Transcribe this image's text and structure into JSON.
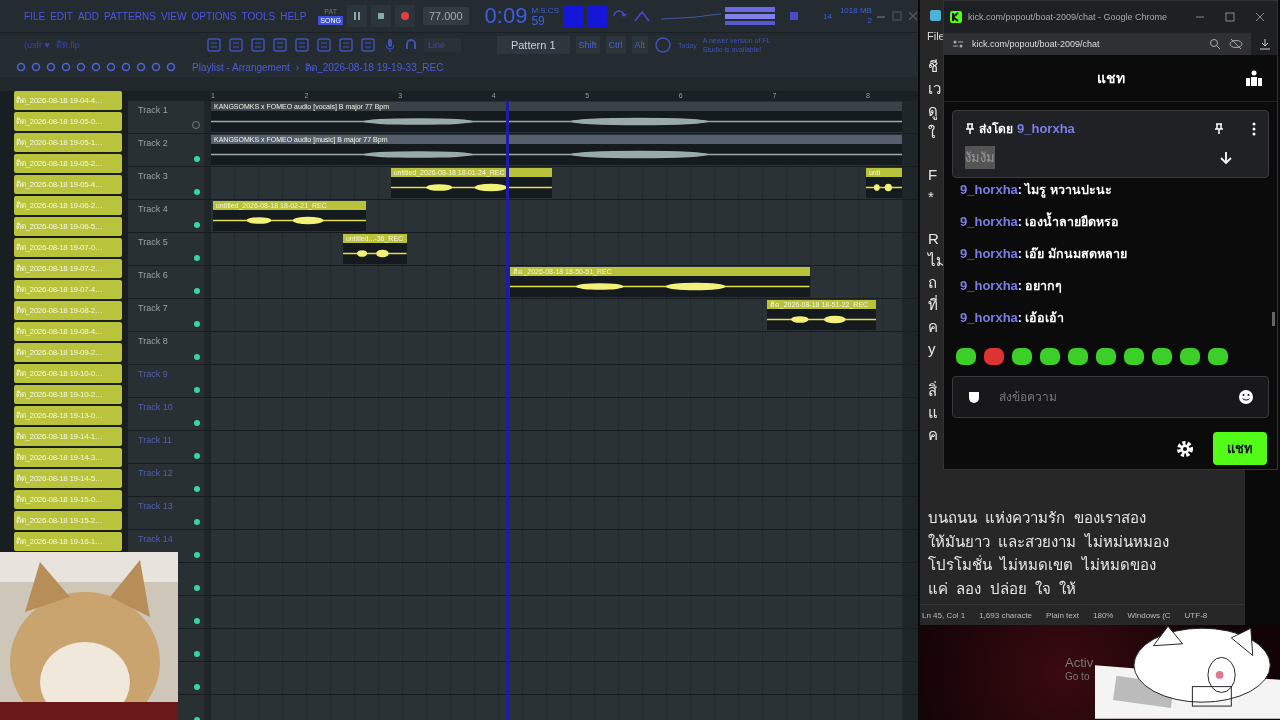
{
  "fl_studio": {
    "menu": [
      "FILE",
      "EDIT",
      "ADD",
      "PATTERNS",
      "VIEW",
      "OPTIONS",
      "TOOLS",
      "HELP"
    ],
    "mode": [
      {
        "label": "PAT",
        "selected": false
      },
      {
        "label": "SONG",
        "selected": true
      }
    ],
    "tempo": "77.000",
    "time": "0:09",
    "time_cs": "59",
    "time_unit": "M:S:CS",
    "cpu": "14",
    "memory": "1018 MB",
    "polyphony": "2",
    "hint": "(usfr ♥",
    "project": "ติด.flp",
    "snap": "Line",
    "pattern": "Pattern 1",
    "keys": [
      "Shift",
      "Ctrl",
      "Alt"
    ],
    "news_day": "Today",
    "news": "A newer version of FL Studio is available!",
    "playlist_title": "Playlist - Arrangement",
    "playlist_separator": "›",
    "playlist_pattern": "ติด_2026-08-18 19-19-33_REC",
    "browser_items": [
      "ติด_2026-08-18 19-04-4…",
      "ติด_2026-08-18 19-05-0…",
      "ติด_2026-08-18 19-05-1…",
      "ติด_2026-08-18 19-05-2…",
      "ติด_2026-08-18 19-05-4…",
      "ติด_2026-08-18 19-06-2…",
      "ติด_2026-08-18 19-06-5…",
      "ติด_2026-08-18 19-07-0…",
      "ติด_2026-08-18 19-07-2…",
      "ติด_2026-08-18 19-07-4…",
      "ติด_2026-08-18 19-08-2…",
      "ติด_2026-08-18 19-08-4…",
      "ติด_2026-08-18 19-09-2…",
      "ติด_2026-08-18 19-10-0…",
      "ติด_2026-08-18 19-10-2…",
      "ติด_2026-08-18 19-13-0…",
      "ติด_2026-08-18 19-14-1…",
      "ติด_2026-08-18 19-14-3…",
      "ติด_2026-08-18 19-14-5…",
      "ติด_2026-08-18 19-15-0…",
      "ติด_2026-08-18 19-15-2…",
      "ติด_2026-08-18 19-16-1…"
    ],
    "ruler": [
      "1",
      "2",
      "3",
      "4",
      "5",
      "6",
      "7",
      "8"
    ],
    "tracks": [
      {
        "label": "Track 1",
        "muted": true,
        "empty": false,
        "clips": [
          {
            "name": "KANGSOMKS x FOMEO audio [vocals] B major 77 Bpm",
            "color": "#3a4248"
          }
        ]
      },
      {
        "label": "Track 2",
        "muted": false,
        "empty": false,
        "clips": [
          {
            "name": "KANGSOMKS x FOMEO audio [music] B major 77 Bpm",
            "color": "#56606c"
          }
        ]
      },
      {
        "label": "Track 3",
        "muted": false,
        "empty": false,
        "clips": [
          {
            "name": "untitled_2026-08-18 18-01-24_REC",
            "color": "#b8c23a"
          },
          {
            "name": "unti",
            "color": "#b8c23a"
          }
        ]
      },
      {
        "label": "Track 4",
        "muted": false,
        "empty": false,
        "clips": [
          {
            "name": "untitled_2026-08-18 18-02-21_REC",
            "color": "#b8c23a"
          }
        ]
      },
      {
        "label": "Track 5",
        "muted": false,
        "empty": false,
        "clips": [
          {
            "name": "untitled...-36_REC",
            "color": "#b8c23a"
          }
        ]
      },
      {
        "label": "Track 6",
        "muted": false,
        "empty": false,
        "clips": [
          {
            "name": "ติด_2026-08-18 18-50-51_REC",
            "color": "#b8c23a"
          }
        ]
      },
      {
        "label": "Track 7",
        "muted": false,
        "empty": false,
        "clips": [
          {
            "name": "ติด_2026-08-18 18-51-22_REC",
            "color": "#b8c23a"
          }
        ]
      },
      {
        "label": "Track 8",
        "muted": false,
        "empty": false
      },
      {
        "label": "Track 9",
        "muted": false,
        "empty": true
      },
      {
        "label": "Track 10",
        "muted": false,
        "empty": true
      },
      {
        "label": "Track 11",
        "muted": false,
        "empty": true
      },
      {
        "label": "Track 12",
        "muted": false,
        "empty": true
      },
      {
        "label": "Track 13",
        "muted": false,
        "empty": true
      },
      {
        "label": "Track 14",
        "muted": false,
        "empty": true
      },
      {
        "muted": false
      },
      {
        "muted": false
      },
      {
        "muted": false
      },
      {
        "muted": false
      },
      {
        "muted": false
      }
    ]
  },
  "notepad": {
    "menu": "File",
    "paragraphs": [
      [
        "ชี",
        "เว",
        "ดู",
        "ใ"
      ],
      [
        "F",
        "*"
      ],
      [
        "R",
        "ไม",
        "ถ",
        "ที่",
        "ค",
        "y"
      ],
      [
        "สิ่",
        "แ",
        "ค"
      ]
    ],
    "lines": [
      "บนถนน  แห่งความรัก  ของเราสอง",
      "ให้มันยาว  และสวยงาม  ไม่หม่นหมอง",
      "โปรโมชั่น  ไม่หมดเขต  ไม่หมดของ",
      "แค่  ลอง  ปล่อย  ใจ  ให้"
    ],
    "status": [
      "Ln 45, Col 1",
      "1,693 characte",
      "Plain text",
      "180%",
      "Windows (C",
      "UTF-8"
    ]
  },
  "chrome": {
    "title": "kick.com/popout/boat-2009/chat - Google Chrome",
    "url": "kick.com/popout/boat-2009/chat",
    "header": "แชท",
    "pinned": {
      "prefix": "ส่งโดย",
      "user": "9_horxha",
      "message": "งัมงัม"
    },
    "messages": [
      {
        "user": "9_horxha",
        "text": ": ไมรู หวานปะนะ"
      },
      {
        "user": "9_horxha",
        "text": ": เองน้ำลายยืดหรอ"
      },
      {
        "user": "9_horxha",
        "text": ": เอ๊ย มักนมสดหลาย"
      },
      {
        "user": "9_horxha",
        "text": ": อยากๆ"
      },
      {
        "user": "9_horxha",
        "text": ": เอ้อเอ้า"
      }
    ],
    "placeholder": "ส่งข้อความ",
    "send": "แชท"
  },
  "desktop": {
    "notice": [
      "Activ",
      "Go to"
    ]
  }
}
